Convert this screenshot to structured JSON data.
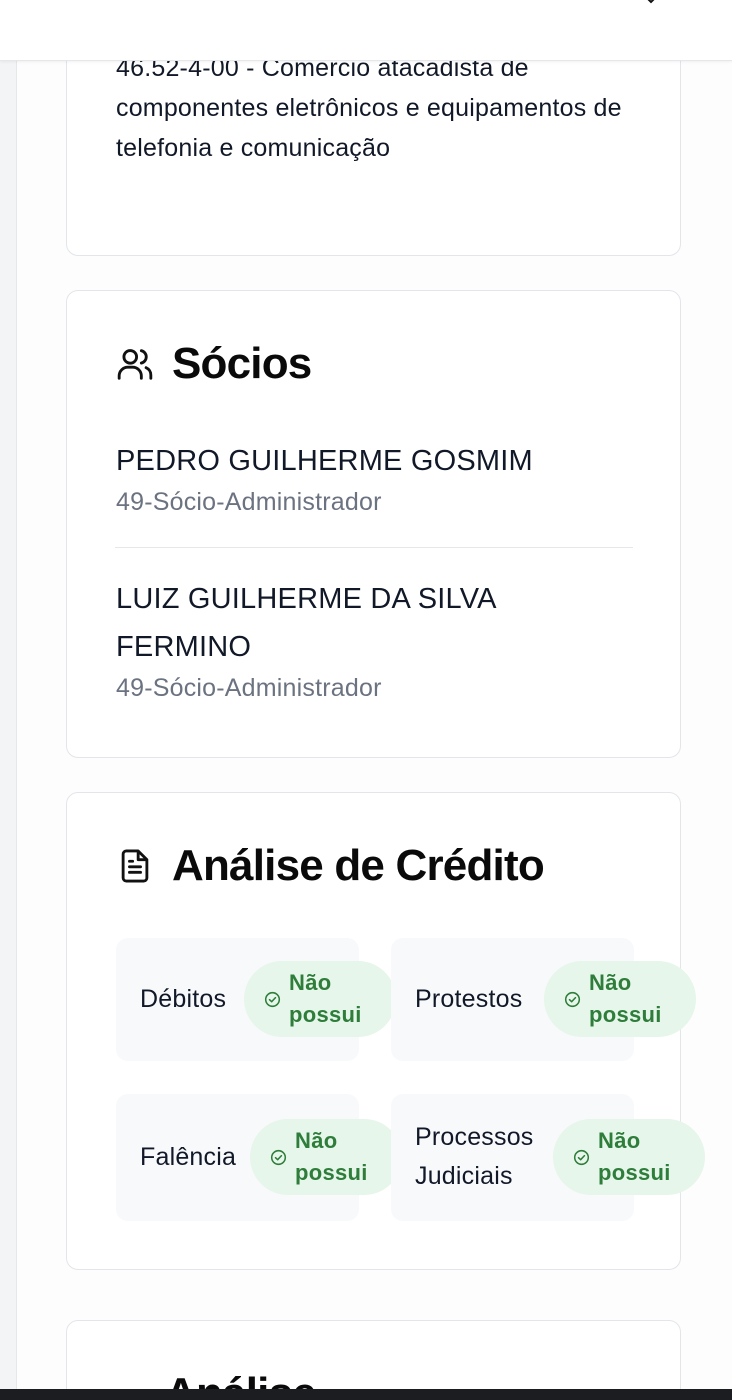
{
  "activity": {
    "text": "46.52-4-00 - Comércio atacadista de componentes eletrônicos e equipamentos de telefonia e comunicação"
  },
  "socios": {
    "title": "Sócios",
    "icon": "users-icon",
    "partners": [
      {
        "name": "PEDRO GUILHERME GOSMIM",
        "role": "49-Sócio-Administrador"
      },
      {
        "name": "LUIZ GUILHERME DA SILVA FERMINO",
        "role": "49-Sócio-Administrador"
      }
    ]
  },
  "credito": {
    "title": "Análise de Crédito",
    "icon": "document-icon",
    "items": [
      {
        "label": "Débitos",
        "status": "Não possui"
      },
      {
        "label": "Protestos",
        "status": "Não possui"
      },
      {
        "label": "Falência",
        "status": "Não possui"
      },
      {
        "label": "Processos Judiciais",
        "status": "Não possui"
      }
    ]
  },
  "next_section": {
    "title": "Análise"
  },
  "colors": {
    "badge_bg": "#e6f6ea",
    "badge_text": "#2f7d3b",
    "muted_text": "#6b7280"
  }
}
